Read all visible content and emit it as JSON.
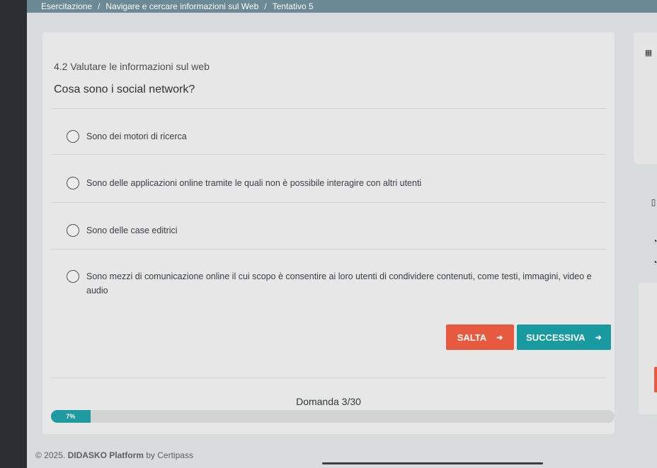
{
  "breadcrumb": {
    "items": [
      "Esercitazione",
      "Navigare e cercare informazioni sul Web",
      "Tentativo 5"
    ],
    "separator": "/"
  },
  "quiz": {
    "section_title": "4.2 Valutare le informazioni sul web",
    "question": "Cosa sono i social network?",
    "options": [
      "Sono dei motori di ricerca",
      "Sono delle applicazioni online tramite le quali non è possibile interagire con altri utenti",
      "Sono delle case editrici",
      "Sono mezzi di comunicazione online il cui scopo è consentire ai loro utenti di condividere contenuti, come testi, immagini, video e audio"
    ],
    "skip_label": "SALTA",
    "next_label": "SUCCESSIVA",
    "counter": "Domanda 3/30",
    "progress_label": "7%",
    "progress_fraction": 0.07
  },
  "footer": {
    "copyright": "© 2025.",
    "platform": "DIDASKO Platform",
    "by": "by Certipass"
  },
  "colors": {
    "topbar": "#6b8a95",
    "skip_button": "#e85a3f",
    "next_button": "#199aa0",
    "progress": "#1e9aa0"
  },
  "icons": {
    "arrow": "arrow-right-icon",
    "side": [
      "calculator-icon",
      "document-icon",
      "clock-icon",
      "clock-icon"
    ]
  }
}
